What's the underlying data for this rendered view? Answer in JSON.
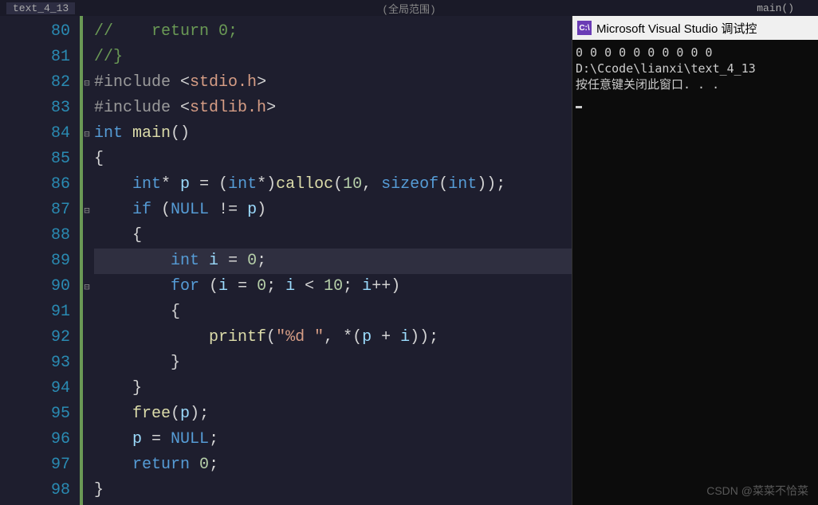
{
  "tabs": {
    "left": "text_4_13",
    "center": "(全局范围)",
    "right": "main()"
  },
  "lineNumbers": [
    "80",
    "81",
    "82",
    "83",
    "84",
    "85",
    "86",
    "87",
    "88",
    "89",
    "90",
    "91",
    "92",
    "93",
    "94",
    "95",
    "96",
    "97",
    "98"
  ],
  "foldMarks": [
    "",
    "",
    "⊟",
    "",
    "⊟",
    "",
    "",
    "⊟",
    "",
    "",
    "⊟",
    "",
    "",
    "",
    "",
    "",
    "",
    "",
    ""
  ],
  "code": {
    "l80_a": "//    ",
    "l80_b": "return",
    "l80_c": " 0;",
    "l81": "//}",
    "l82_a": "#include",
    "l82_b": " ",
    "l82_c": "<stdio.h>",
    "l83_a": "#include",
    "l83_b": " ",
    "l83_c": "<stdlib.h>",
    "l84_a": "int",
    "l84_b": " ",
    "l84_c": "main",
    "l84_d": "()",
    "l85": "{",
    "l86_a": "    ",
    "l86_b": "int",
    "l86_c": "* ",
    "l86_d": "p",
    "l86_e": " = (",
    "l86_f": "int",
    "l86_g": "*)",
    "l86_h": "calloc",
    "l86_i": "(",
    "l86_j": "10",
    "l86_k": ", ",
    "l86_l": "sizeof",
    "l86_m": "(",
    "l86_n": "int",
    "l86_o": "));",
    "l87_a": "    ",
    "l87_b": "if",
    "l87_c": " (",
    "l87_d": "NULL",
    "l87_e": " != ",
    "l87_f": "p",
    "l87_g": ")",
    "l88": "    {",
    "l89_a": "        ",
    "l89_b": "int",
    "l89_c": " ",
    "l89_d": "i",
    "l89_e": " = ",
    "l89_f": "0",
    "l89_g": ";",
    "l90_a": "        ",
    "l90_b": "for",
    "l90_c": " (",
    "l90_d": "i",
    "l90_e": " = ",
    "l90_f": "0",
    "l90_g": "; ",
    "l90_h": "i",
    "l90_i": " < ",
    "l90_j": "10",
    "l90_k": "; ",
    "l90_l": "i",
    "l90_m": "++)",
    "l91": "        {",
    "l92_a": "            ",
    "l92_b": "printf",
    "l92_c": "(",
    "l92_d": "\"%d \"",
    "l92_e": ", *(",
    "l92_f": "p",
    "l92_g": " + ",
    "l92_h": "i",
    "l92_i": "));",
    "l93": "        }",
    "l94": "    }",
    "l95_a": "    ",
    "l95_b": "free",
    "l95_c": "(",
    "l95_d": "p",
    "l95_e": ");",
    "l96_a": "    ",
    "l96_b": "p",
    "l96_c": " = ",
    "l96_d": "NULL",
    "l96_e": ";",
    "l97_a": "    ",
    "l97_b": "return",
    "l97_c": " ",
    "l97_d": "0",
    "l97_e": ";",
    "l98": "}"
  },
  "console": {
    "title": "Microsoft Visual Studio 调试控",
    "iconText": "C:\\",
    "output_line1": "0 0 0 0 0 0 0 0 0 0",
    "output_line2": "D:\\Ccode\\lianxi\\text_4_13",
    "output_line3": "按任意键关闭此窗口. . ."
  },
  "watermark": "CSDN @菜菜不恰菜"
}
